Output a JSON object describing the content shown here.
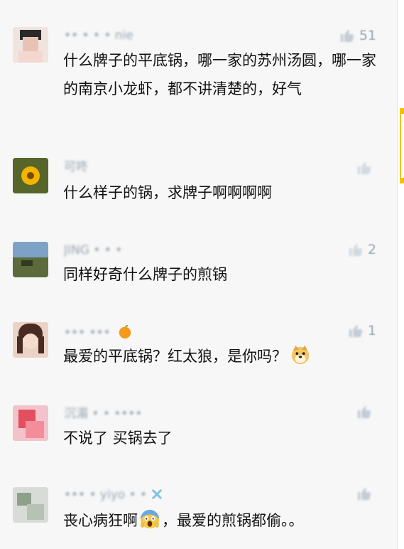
{
  "comments": [
    {
      "name": "•• • • • nie",
      "text": "什么牌子的平底锅，哪一家的苏州汤圆，哪一家的南京小龙虾，都不讲清楚的，好气",
      "likes": "51"
    },
    {
      "name": "可咚",
      "text": "什么样子的锅，求牌子啊啊啊啊",
      "likes": ""
    },
    {
      "name": "JING • • •",
      "text": "同样好奇什么牌子的煎锅",
      "likes": "2"
    },
    {
      "name": "••• •••",
      "text": "最爱的平底锅？红太狼，是你吗？",
      "likes": "1"
    },
    {
      "name": "沉湄 • • ••••",
      "text": "不说了 买锅去了",
      "likes": ""
    },
    {
      "name": "••• • yiyo • •",
      "text_before": "丧心病狂啊",
      "text_after": "，最爱的煎锅都偷。。",
      "likes": ""
    }
  ],
  "icons": {
    "like": "thumbs-up-icon",
    "name_emoji_4": "tangerine-emoji",
    "name_emoji_6": "x-sparkle-emoji",
    "text_emoji_4": "doge-emoji",
    "text_emoji_6": "screaming-face-emoji"
  },
  "colors": {
    "background": "#f7f7f7",
    "name": "#9aa4b1",
    "text": "#111111",
    "like": "#9aa4b1"
  }
}
